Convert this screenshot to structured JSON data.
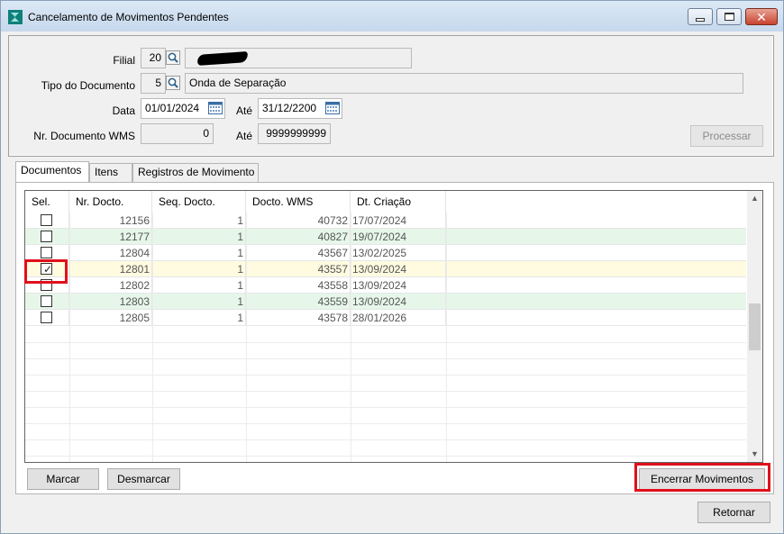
{
  "window": {
    "title": "Cancelamento de Movimentos Pendentes"
  },
  "filter": {
    "filial_label": "Filial",
    "filial_code": "20",
    "tipo_label": "Tipo do Documento",
    "tipo_code": "5",
    "tipo_desc": "Onda de Separação",
    "data_label": "Data",
    "data_from": "01/01/2024",
    "ate_label": "Até",
    "data_to": "31/12/2200",
    "nrdoc_label": "Nr. Documento WMS",
    "nrdoc_from": "0",
    "nrdoc_to": "9999999999",
    "processar_label": "Processar"
  },
  "tabs": [
    {
      "label": "Documentos"
    },
    {
      "label": "Itens"
    },
    {
      "label": "Registros de Movimento"
    }
  ],
  "grid": {
    "columns": [
      "Sel.",
      "Nr. Docto.",
      "Seq. Docto.",
      "Docto. WMS",
      "Dt. Criação"
    ],
    "rows": [
      {
        "checked": false,
        "nr": "12156",
        "seq": "1",
        "wms": "40732",
        "date": "17/07/2024",
        "tone": "white"
      },
      {
        "checked": false,
        "nr": "12177",
        "seq": "1",
        "wms": "40827",
        "date": "19/07/2024",
        "tone": "green"
      },
      {
        "checked": false,
        "nr": "12804",
        "seq": "1",
        "wms": "43567",
        "date": "13/02/2025",
        "tone": "white"
      },
      {
        "checked": true,
        "nr": "12801",
        "seq": "1",
        "wms": "43557",
        "date": "13/09/2024",
        "tone": "yellow"
      },
      {
        "checked": false,
        "nr": "12802",
        "seq": "1",
        "wms": "43558",
        "date": "13/09/2024",
        "tone": "white"
      },
      {
        "checked": false,
        "nr": "12803",
        "seq": "1",
        "wms": "43559",
        "date": "13/09/2024",
        "tone": "green"
      },
      {
        "checked": false,
        "nr": "12805",
        "seq": "1",
        "wms": "43578",
        "date": "28/01/2026",
        "tone": "white"
      }
    ]
  },
  "buttons": {
    "marcar": "Marcar",
    "desmarcar": "Desmarcar",
    "encerrar": "Encerrar Movimentos",
    "retornar": "Retornar"
  },
  "colors": {
    "highlight": "#e0101c",
    "row_green": "#e6f7ea",
    "row_yellow": "#fffbe0"
  },
  "icons": {
    "lookup": "magnifier-icon",
    "calendar": "calendar-icon",
    "checkbox_checked": "check-icon"
  }
}
